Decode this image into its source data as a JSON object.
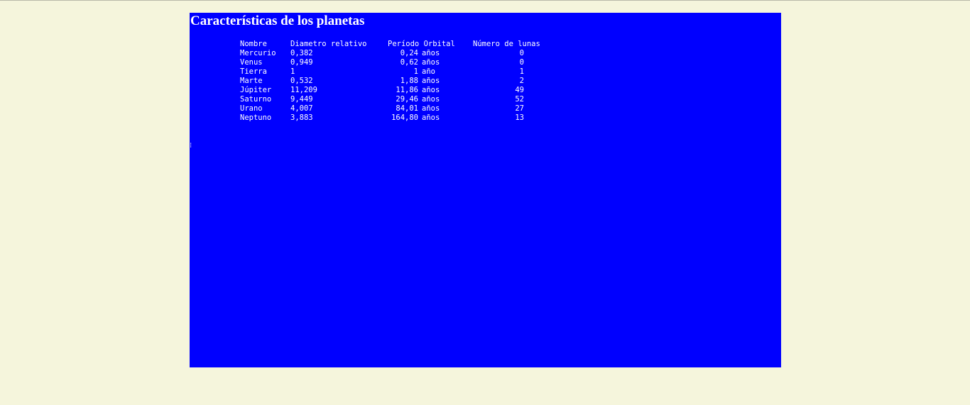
{
  "page": {
    "title": "Características de los planetas",
    "colors": {
      "page_background": "#f5f5dc",
      "panel_background": "#0000ff",
      "text": "#ffffff"
    }
  },
  "table": {
    "headers": {
      "name": "Nombre",
      "diameter": "Diametro relativo",
      "period": "Período Orbital",
      "moons": "Número de lunas"
    },
    "rows": [
      {
        "name": "Mercurio",
        "diameter": "0,382",
        "period": "0,24",
        "unit": "años",
        "moons": "0"
      },
      {
        "name": "Venus",
        "diameter": "0,949",
        "period": "0,62",
        "unit": "años",
        "moons": "0"
      },
      {
        "name": "Tierra",
        "diameter": "1",
        "period": "1",
        "unit": "año",
        "moons": "1"
      },
      {
        "name": "Marte",
        "diameter": "0,532",
        "period": "1,88",
        "unit": "años",
        "moons": "2"
      },
      {
        "name": "Júpiter",
        "diameter": "11,209",
        "period": "11,86",
        "unit": "años",
        "moons": "49"
      },
      {
        "name": "Saturno",
        "diameter": "9,449",
        "period": "29,46",
        "unit": "años",
        "moons": "52"
      },
      {
        "name": "Urano",
        "diameter": "4,007",
        "period": "84,01",
        "unit": "años",
        "moons": "27"
      },
      {
        "name": "Neptuno",
        "diameter": "3,883",
        "period": "164,80",
        "unit": "años",
        "moons": "13"
      }
    ]
  }
}
